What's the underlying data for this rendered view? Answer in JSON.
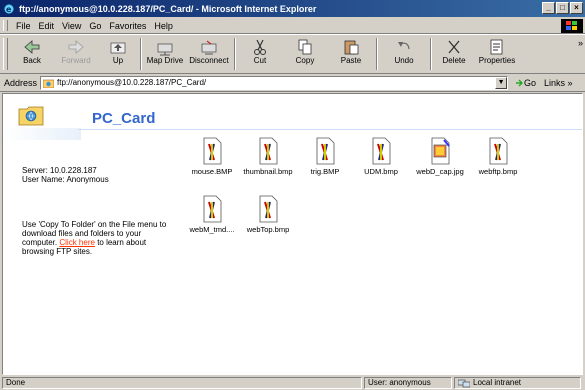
{
  "window": {
    "title": "ftp://anonymous@10.0.228.187/PC_Card/ - Microsoft Internet Explorer",
    "buttons": [
      "_",
      "□",
      "×"
    ]
  },
  "menu": [
    "File",
    "Edit",
    "View",
    "Go",
    "Favorites",
    "Help"
  ],
  "toolbar": {
    "buttons": [
      {
        "label": "Back",
        "icon": "back-arrow-icon",
        "enabled": true
      },
      {
        "label": "Forward",
        "icon": "forward-arrow-icon",
        "enabled": false
      },
      {
        "label": "Up",
        "icon": "up-folder-icon",
        "enabled": true
      },
      {
        "label": "Map Drive",
        "icon": "map-drive-icon",
        "enabled": true
      },
      {
        "label": "Disconnect",
        "icon": "disconnect-icon",
        "enabled": true
      },
      {
        "label": "Cut",
        "icon": "cut-icon",
        "enabled": true
      },
      {
        "label": "Copy",
        "icon": "copy-icon",
        "enabled": true
      },
      {
        "label": "Paste",
        "icon": "paste-icon",
        "enabled": true
      },
      {
        "label": "Undo",
        "icon": "undo-icon",
        "enabled": true
      },
      {
        "label": "Delete",
        "icon": "delete-icon",
        "enabled": true
      },
      {
        "label": "Properties",
        "icon": "properties-icon",
        "enabled": true
      }
    ],
    "overflow": "»"
  },
  "address": {
    "label": "Address",
    "value": "ftp://anonymous@10.0.228.187/PC_Card/",
    "go_label": "Go",
    "links_label": "Links »"
  },
  "content": {
    "heading": "PC_Card",
    "server_line": "Server: 10.0.228.187",
    "user_line": "User Name: Anonymous",
    "help_before": "Use 'Copy To Folder' on the File menu to download files and folders to your computer.",
    "help_link": "Click here",
    "help_after": "to learn about browsing FTP sites.",
    "files": [
      {
        "name": "mouse.BMP",
        "icon": "bmp-file-icon"
      },
      {
        "name": "thumbnail.bmp",
        "icon": "bmp-file-icon"
      },
      {
        "name": "trig.BMP",
        "icon": "bmp-file-icon"
      },
      {
        "name": "UDM.bmp",
        "icon": "bmp-file-icon"
      },
      {
        "name": "webD_cap.jpg",
        "icon": "jpg-file-icon"
      },
      {
        "name": "webftp.bmp",
        "icon": "bmp-file-icon"
      },
      {
        "name": "webM_tmd....",
        "icon": "bmp-file-icon"
      },
      {
        "name": "webTop.bmp",
        "icon": "bmp-file-icon"
      }
    ]
  },
  "status": {
    "left": "Done",
    "user": "User: anonymous",
    "zone": "Local intranet"
  },
  "colors": {
    "heading": "#3366cc",
    "link": "#ff3300",
    "titlebar_start": "#0a246a",
    "titlebar_end": "#3a6ea5"
  }
}
